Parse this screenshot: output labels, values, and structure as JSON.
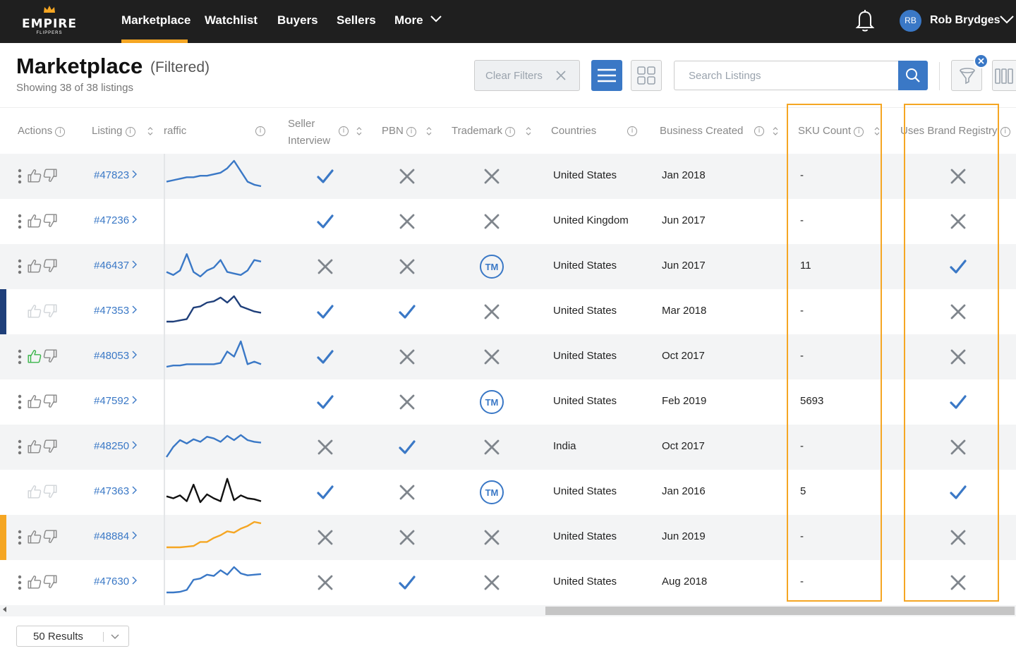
{
  "brand": {
    "name": "EMPIRE",
    "sub": "FLIPPERS",
    "gold": "#f5a623",
    "blue": "#3a78c6"
  },
  "nav": {
    "items": [
      {
        "label": "Marketplace"
      },
      {
        "label": "Watchlist"
      },
      {
        "label": "Buyers"
      },
      {
        "label": "Sellers"
      },
      {
        "label": "More"
      }
    ],
    "user": {
      "initials": "RB",
      "name": "Rob Brydges"
    }
  },
  "header": {
    "title": "Marketplace",
    "filtered": "(Filtered)",
    "subtitle": "Showing 38 of 38 listings",
    "clear_filters": "Clear Filters",
    "search_placeholder": "Search Listings",
    "search_value": ""
  },
  "table": {
    "columns": [
      {
        "label": "Actions"
      },
      {
        "label": "Listing"
      },
      {
        "label": "raffic"
      },
      {
        "label": "Seller Interview"
      },
      {
        "label": "PBN"
      },
      {
        "label": "Trademark"
      },
      {
        "label": "Countries"
      },
      {
        "label": "Business Created"
      },
      {
        "label": "SKU Count"
      },
      {
        "label": "Uses Brand Registry"
      }
    ],
    "rows": [
      {
        "id": "#47823",
        "interview": "check",
        "pbn": "x",
        "trademark": "x",
        "country": "United States",
        "created": "Jan 2018",
        "sku": "-",
        "brand_registry": "x",
        "like": "default",
        "menu": true,
        "mark": "",
        "spark": "blue",
        "traffic": [
          14,
          13,
          12,
          11,
          11,
          10,
          10,
          9,
          8,
          5,
          0,
          7,
          14,
          16,
          17
        ]
      },
      {
        "id": "#47236",
        "interview": "check",
        "pbn": "x",
        "trademark": "x",
        "country": "United Kingdom",
        "created": "Jun 2017",
        "sku": "-",
        "brand_registry": "x",
        "like": "default",
        "menu": true,
        "mark": "",
        "spark": "none",
        "traffic": []
      },
      {
        "id": "#46437",
        "interview": "x",
        "pbn": "x",
        "trademark": "tm",
        "country": "United States",
        "created": "Jun 2017",
        "sku": "11",
        "brand_registry": "check",
        "like": "default",
        "menu": true,
        "mark": "",
        "spark": "blue",
        "traffic": [
          14,
          16,
          13,
          2,
          14,
          17,
          13,
          11,
          6,
          14,
          15,
          16,
          13,
          6,
          7
        ]
      },
      {
        "id": "#47353",
        "interview": "check",
        "pbn": "check",
        "trademark": "x",
        "country": "United States",
        "created": "Mar 2018",
        "sku": "-",
        "brand_registry": "x",
        "like": "faded",
        "menu": false,
        "mark": "#1f3f7a",
        "spark": "navy",
        "traffic": [
          20,
          20,
          19,
          18,
          9,
          8,
          5,
          4,
          1,
          5,
          0,
          8,
          10,
          12,
          13
        ]
      },
      {
        "id": "#48053",
        "interview": "check",
        "pbn": "x",
        "trademark": "x",
        "country": "United States",
        "created": "Oct 2017",
        "sku": "-",
        "brand_registry": "x",
        "like": "green",
        "menu": true,
        "mark": "",
        "spark": "blue",
        "traffic": [
          20,
          19,
          19,
          18,
          18,
          18,
          18,
          18,
          17,
          8,
          12,
          0,
          18,
          16,
          18
        ]
      },
      {
        "id": "#47592",
        "interview": "check",
        "pbn": "x",
        "trademark": "tm",
        "country": "United States",
        "created": "Feb 2019",
        "sku": "5693",
        "brand_registry": "check",
        "like": "default",
        "menu": true,
        "mark": "",
        "spark": "none",
        "traffic": []
      },
      {
        "id": "#48250",
        "interview": "x",
        "pbn": "check",
        "trademark": "x",
        "country": "India",
        "created": "Oct 2017",
        "sku": "-",
        "brand_registry": "x",
        "like": "default",
        "menu": true,
        "mark": "",
        "spark": "blue",
        "traffic": [
          30,
          18,
          10,
          14,
          9,
          12,
          6,
          8,
          12,
          5,
          10,
          4,
          10,
          12,
          13
        ]
      },
      {
        "id": "#47363",
        "interview": "check",
        "pbn": "x",
        "trademark": "tm",
        "country": "United States",
        "created": "Jan 2016",
        "sku": "5",
        "brand_registry": "check",
        "like": "faded",
        "menu": false,
        "mark": "",
        "spark": "black",
        "traffic": [
          20,
          22,
          19,
          25,
          8,
          26,
          18,
          22,
          25,
          2,
          24,
          19,
          22,
          23,
          25
        ]
      },
      {
        "id": "#48884",
        "interview": "x",
        "pbn": "x",
        "trademark": "x",
        "country": "United States",
        "created": "Jun 2019",
        "sku": "-",
        "brand_registry": "x",
        "like": "default",
        "menu": true,
        "mark": "#f5a623",
        "spark": "orange",
        "traffic": [
          38,
          38,
          38,
          37,
          36,
          30,
          30,
          24,
          20,
          14,
          16,
          10,
          6,
          0,
          2
        ]
      },
      {
        "id": "#47630",
        "interview": "x",
        "pbn": "check",
        "trademark": "x",
        "country": "United States",
        "created": "Aug 2018",
        "sku": "-",
        "brand_registry": "x",
        "like": "default",
        "menu": true,
        "mark": "",
        "spark": "blue",
        "traffic": [
          40,
          40,
          39,
          36,
          20,
          18,
          12,
          14,
          5,
          12,
          0,
          10,
          13,
          12,
          11
        ]
      }
    ]
  },
  "footer": {
    "results": "50 Results"
  }
}
